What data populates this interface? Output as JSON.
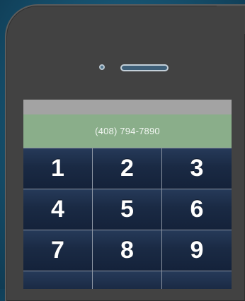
{
  "display": {
    "number": "(408) 794-7890"
  },
  "keypad": {
    "keys": [
      "1",
      "2",
      "3",
      "4",
      "5",
      "6",
      "7",
      "8",
      "9",
      "",
      "",
      ""
    ]
  },
  "colors": {
    "background": "#175371",
    "phone_body": "#424242",
    "status_bar": "#a3a3a3",
    "display": "#8aae8a",
    "key": "#1a2a44",
    "key_text": "#ffffff"
  },
  "icons": {
    "camera": "front-camera-icon",
    "speaker": "earpiece-speaker-icon"
  }
}
